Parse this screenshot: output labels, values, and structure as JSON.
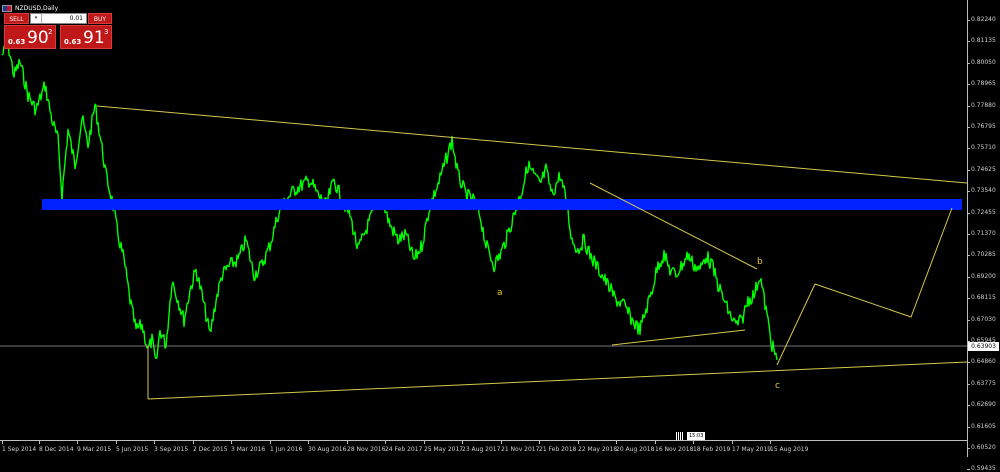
{
  "window": {
    "symbol_title": "NZDUSD,Daily"
  },
  "trade_panel": {
    "sell_label": "SELL",
    "buy_label": "BUY",
    "lot_value": "0.01",
    "lot_dropdown_glyph": "▾",
    "sell_quote": {
      "prefix": "0.63",
      "big": "90",
      "sup": "2"
    },
    "buy_quote": {
      "prefix": "0.63",
      "big": "91",
      "sup": "3"
    }
  },
  "price_axis": {
    "labels": [
      "0.82240",
      "0.81135",
      "0.80050",
      "0.78965",
      "0.77880",
      "0.76795",
      "0.75710",
      "0.74625",
      "0.73540",
      "0.72455",
      "0.71370",
      "0.70285",
      "0.69200",
      "0.68115",
      "0.67030",
      "0.65945",
      "0.64860",
      "0.63775",
      "0.62690",
      "0.61605",
      "0.60520",
      "0.59435"
    ],
    "current_price": "0.63903"
  },
  "time_axis": {
    "labels": [
      "1 Sep 2014",
      "8 Dec 2014",
      "9 Mar 2015",
      "5 Jun 2015",
      "3 Sep 2015",
      "2 Dec 2015",
      "3 Mar 2016",
      "1 Jun 2016",
      "30 Aug 2016",
      "28 Nov 2016",
      "24 Feb 2017",
      "25 May 2017",
      "23 Aug 2017",
      "21 Nov 2017",
      "21 Feb 2018",
      "22 May 2018",
      "20 Aug 2018",
      "16 Nov 2018",
      "18 Feb 2019",
      "17 May 2019",
      "15 Aug 2019"
    ],
    "marker_time": "15:03"
  },
  "annotations": {
    "wave_a": "a",
    "wave_b": "b",
    "wave_c": "c"
  },
  "colors": {
    "background": "#000000",
    "candles": "#00ff00",
    "trendlines": "#d4c84a",
    "zone": "#0022ff",
    "wave_labels": "#e8c832",
    "bid_line": "#bdbdbd"
  }
}
